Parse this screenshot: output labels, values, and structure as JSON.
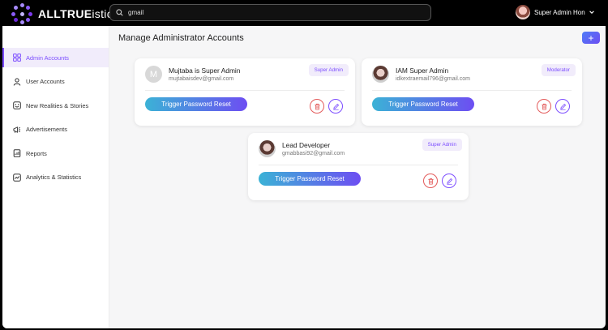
{
  "header": {
    "brand_bold": "ALLTRUE",
    "brand_light": "istic",
    "search": {
      "value": "gmail",
      "placeholder": ""
    },
    "user": {
      "name": "Super Admin Hon"
    }
  },
  "sidebar": {
    "items": [
      {
        "label": "Admin Accounts",
        "icon": "grid-icon",
        "active": true
      },
      {
        "label": "User Accounts",
        "icon": "user-icon",
        "active": false
      },
      {
        "label": "New Realities & Stories",
        "icon": "stories-icon",
        "active": false
      },
      {
        "label": "Advertisements",
        "icon": "megaphone-icon",
        "active": false
      },
      {
        "label": "Reports",
        "icon": "report-icon",
        "active": false
      },
      {
        "label": "Analytics & Statistics",
        "icon": "chart-icon",
        "active": false
      }
    ]
  },
  "main": {
    "title": "Manage Administrator Accounts",
    "add_label": "+",
    "cards": [
      {
        "avatar_initial": "M",
        "name": "Mujtaba is Super Admin",
        "email": "mujtabaisdev@gmail.com",
        "role": "Super Admin",
        "reset_label": "Trigger Password Reset"
      },
      {
        "avatar_initial": "",
        "name": "IAM Super Admin",
        "email": "idkextraemail796@gmail.com",
        "role": "Moderator",
        "reset_label": "Trigger Password Reset"
      },
      {
        "avatar_initial": "",
        "name": "Lead Developer",
        "email": "gmabbasi92@gmail.com",
        "role": "Super Admin",
        "reset_label": "Trigger Password Reset"
      }
    ]
  },
  "colors": {
    "accent": "#7c4dff",
    "danger": "#e35b5b",
    "gradient_start": "#3bb2d6",
    "gradient_end": "#6d4ef2"
  }
}
